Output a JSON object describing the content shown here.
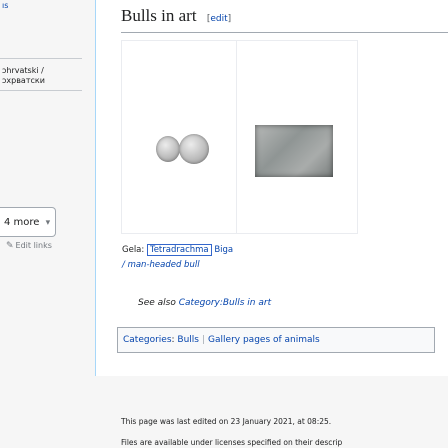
{
  "sidebar": {
    "top_fragment": "ıs",
    "lang_items": [
      "ɔhrvatski /",
      "ɔxpватски"
    ],
    "more_label": "4 more",
    "edit_links": "Edit links"
  },
  "page": {
    "heading": "Bulls in art",
    "edit_label": "edit",
    "caption": {
      "prefix": "Gela: ",
      "boxed_link": "Tetradrachma",
      "suffix": "Biga",
      "line2": "/ man-headed bull"
    },
    "see_also": {
      "prefix": "See also ",
      "link": "Category:Bulls in art"
    },
    "categories": {
      "label": "Categories",
      "items": [
        "Bulls",
        "Gallery pages of animals"
      ]
    }
  },
  "footer": {
    "last_edited": "This page was last edited on 23 January 2021, at 08:25.",
    "license": "Files are available under licenses specified on their descrip"
  }
}
